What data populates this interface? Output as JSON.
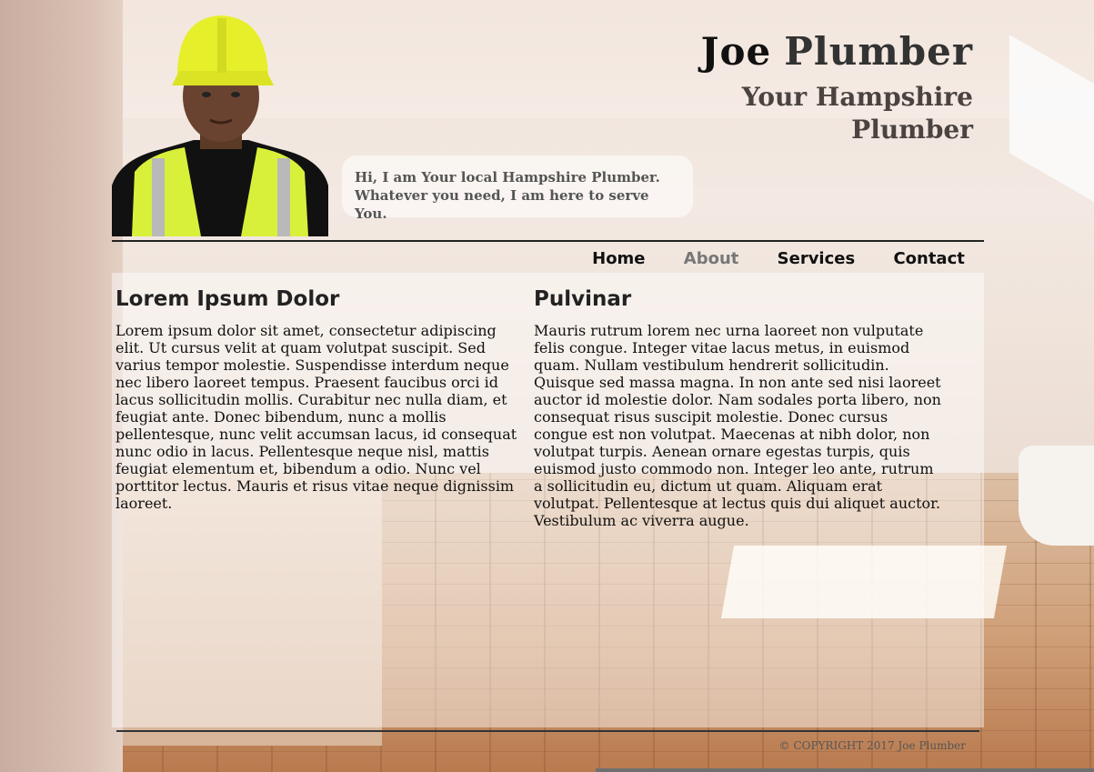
{
  "header": {
    "name_first": "Joe",
    "name_last": "Plumber",
    "subtitle": "Your Hampshire Plumber",
    "speech": "Hi, I am Your local Hampshire Plumber. Whatever you need, I am here to serve You."
  },
  "nav": {
    "items": [
      {
        "label": "Home",
        "active": false
      },
      {
        "label": "About",
        "active": true
      },
      {
        "label": "Services",
        "active": false
      },
      {
        "label": "Contact",
        "active": false
      }
    ]
  },
  "content": {
    "left": {
      "heading": "Lorem Ipsum Dolor",
      "body": "Lorem ipsum dolor sit amet, consectetur adipiscing elit. Ut cursus velit at quam volutpat suscipit. Sed varius tempor molestie. Suspendisse interdum neque nec libero laoreet tempus. Praesent faucibus orci id lacus sollicitudin mollis. Curabitur nec nulla diam, et feugiat ante. Donec bibendum, nunc a mollis pellentesque, nunc velit accumsan lacus, id consequat nunc odio in lacus. Pellentesque neque nisl, mattis feugiat elementum et, bibendum a odio. Nunc vel porttitor lectus. Mauris et risus vitae neque dignissim laoreet."
    },
    "right": {
      "heading": "Pulvinar",
      "body": "Mauris rutrum lorem nec urna laoreet non vulputate felis congue. Integer vitae lacus metus, in euismod quam. Nullam vestibulum hendrerit sollicitudin. Quisque sed massa magna. In non ante sed nisi laoreet auctor id molestie dolor. Nam sodales porta libero, non consequat risus suscipit molestie. Donec cursus congue est non volutpat. Maecenas at nibh dolor, non volutpat turpis. Aenean ornare egestas turpis, quis euismod justo commodo non. Integer leo ante, rutrum a sollicitudin eu, dictum ut quam. Aliquam erat volutpat. Pellentesque at lectus quis dui aliquet auctor. Vestibulum ac viverra augue."
    }
  },
  "footer": {
    "copyright": "© COPYRIGHT 2017 Joe Plumber"
  },
  "colors": {
    "helmet": "#e6ef2a",
    "vest": "#d9f03a",
    "nav_active": "#777777"
  }
}
